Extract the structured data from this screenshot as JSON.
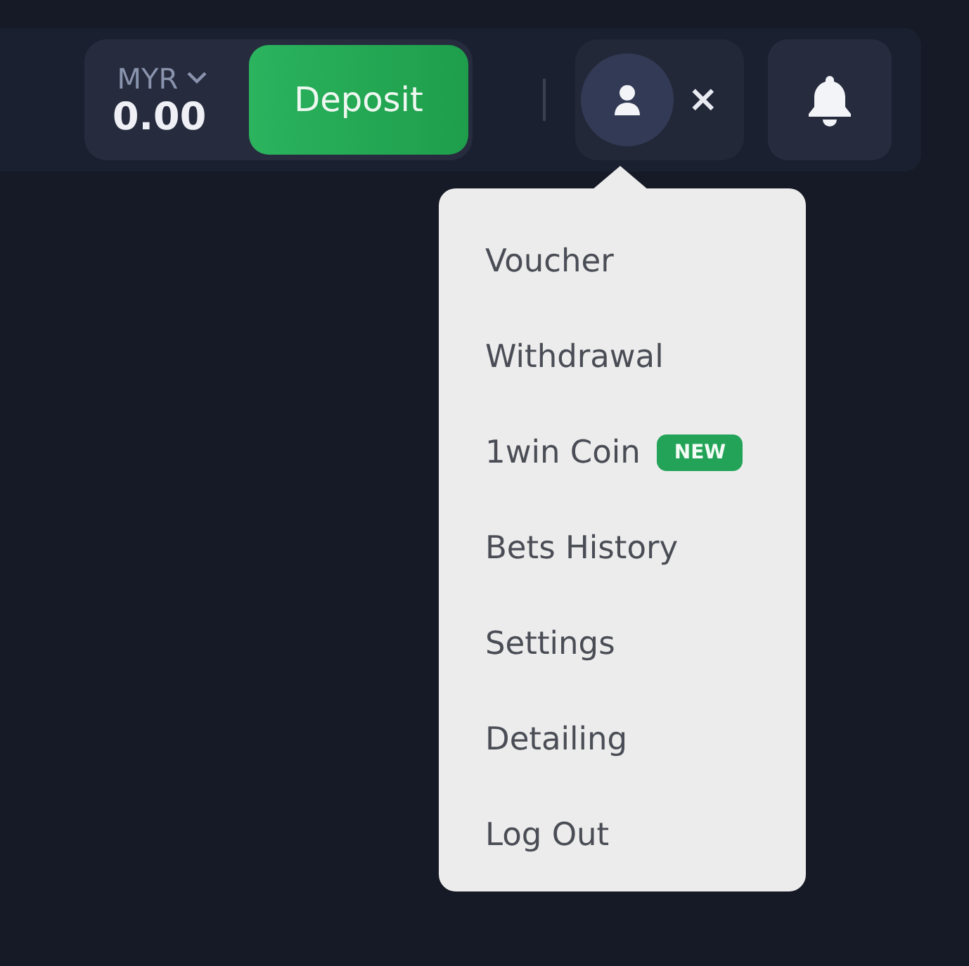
{
  "balance": {
    "currency": "MYR",
    "amount": "0.00"
  },
  "deposit_button": "Deposit",
  "profile_menu": {
    "expanded": true,
    "close": "×",
    "items": [
      {
        "label": "Voucher"
      },
      {
        "label": "Withdrawal"
      },
      {
        "label": "1win Coin",
        "badge": "NEW"
      },
      {
        "label": "Bets History"
      },
      {
        "label": "Settings"
      },
      {
        "label": "Detailing"
      },
      {
        "label": "Log Out"
      }
    ]
  }
}
